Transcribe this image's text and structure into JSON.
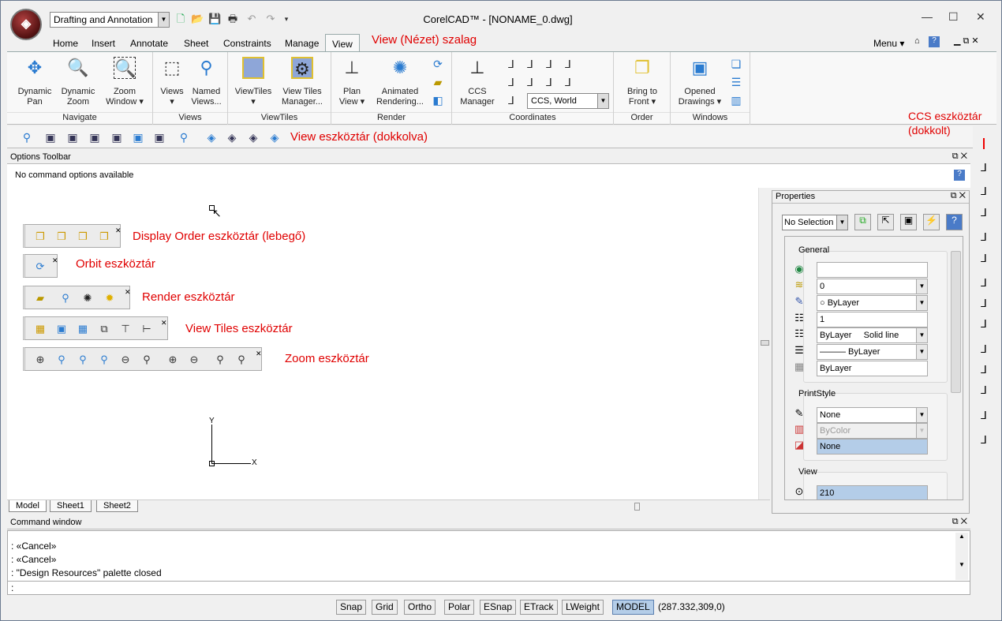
{
  "app": {
    "title": "CorelCAD™ - [NONAME_0.dwg]",
    "logo": "CorelCAD logo",
    "workspace": "Drafting and Annotation"
  },
  "window_controls": {
    "minimize": "—",
    "maximize": "☐",
    "close": "✕"
  },
  "menu_tabs": [
    "Home",
    "Insert",
    "Annotate",
    "Sheet",
    "Constraints",
    "Manage",
    "View"
  ],
  "active_tab": "View",
  "menu_right": {
    "menu": "Menu ▾",
    "help": "?"
  },
  "annotations": {
    "ribbon": "View (Nézet) szalag",
    "ccs": "CCS eszköztár",
    "ccs2": "(dokkolt)",
    "view_tb": "View eszköztár (dokkolva)",
    "display_order": "Display Order eszköztár (lebegő)",
    "orbit": "Orbit eszköztár",
    "render": "Render eszköztár",
    "view_tiles": "View Tiles eszköztár",
    "zoom": "Zoom eszköztár"
  },
  "ribbon": {
    "navigate": {
      "label": "Navigate",
      "buttons": [
        "Dynamic\nPan",
        "Dynamic\nZoom",
        "Zoom\nWindow ▾"
      ]
    },
    "views": {
      "label": "Views",
      "buttons": [
        "Views\n▾",
        "Named\nViews..."
      ]
    },
    "viewtiles": {
      "label": "ViewTiles",
      "buttons": [
        "ViewTiles\n▾",
        "View Tiles\nManager..."
      ]
    },
    "render": {
      "label": "Render",
      "buttons": [
        "Plan\nView ▾",
        "Animated\nRendering..."
      ]
    },
    "coordinates": {
      "label": "Coordinates",
      "buttons": [
        "CCS\nManager"
      ],
      "ccs_select": "CCS, World"
    },
    "order": {
      "label": "Order",
      "buttons": [
        "Bring to\nFront ▾"
      ]
    },
    "windows": {
      "label": "Windows",
      "buttons": [
        "Opened\nDrawings ▾"
      ]
    }
  },
  "options_toolbar": {
    "title": "Options Toolbar",
    "text": "No command options available"
  },
  "sheet_tabs": [
    "Model",
    "Sheet1",
    "Sheet2"
  ],
  "axis": {
    "x": "X",
    "y": "Y"
  },
  "properties": {
    "title": "Properties",
    "selection": "No Selection",
    "general": {
      "label": "General",
      "values": [
        "",
        "0",
        "○ ByLayer",
        "1",
        "ByLayer     Solid line",
        "——— ByLayer",
        "ByLayer"
      ]
    },
    "printstyle": {
      "label": "PrintStyle",
      "values": [
        "None",
        "ByColor",
        "None"
      ]
    },
    "view": {
      "label": "View",
      "values": [
        "210"
      ]
    }
  },
  "command": {
    "title": "Command window",
    "lines": [
      ": «Cancel»",
      ": «Cancel»",
      ": \"Design Resources\" palette closed"
    ],
    "prompt": ":"
  },
  "status": {
    "buttons": [
      "Snap",
      "Grid",
      "Ortho",
      "Polar",
      "ESnap",
      "ETrack",
      "LWeight",
      "MODEL"
    ],
    "coords": "(287.332,309,0)"
  }
}
